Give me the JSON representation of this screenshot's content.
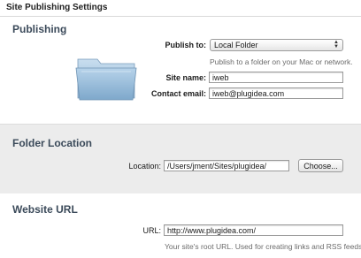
{
  "window": {
    "title": "Site Publishing Settings"
  },
  "publishing": {
    "heading": "Publishing",
    "publish_to_label": "Publish to:",
    "publish_to_value": "Local Folder",
    "publish_to_hint": "Publish to a folder on your Mac or network.",
    "site_name_label": "Site name:",
    "site_name_value": "iweb",
    "contact_email_label": "Contact email:",
    "contact_email_value": "iweb@plugidea.com",
    "folder_icon": "folder-icon"
  },
  "folder_location": {
    "heading": "Folder Location",
    "location_label": "Location:",
    "location_value": "/Users/jment/Sites/plugidea/",
    "choose_label": "Choose..."
  },
  "website_url": {
    "heading": "Website URL",
    "url_label": "URL:",
    "url_value": "http://www.plugidea.com/",
    "url_hint": "Your site's root URL. Used for creating links and RSS feeds."
  },
  "colors": {
    "section_bg": "#ececec",
    "heading": "#3b4a5a"
  }
}
